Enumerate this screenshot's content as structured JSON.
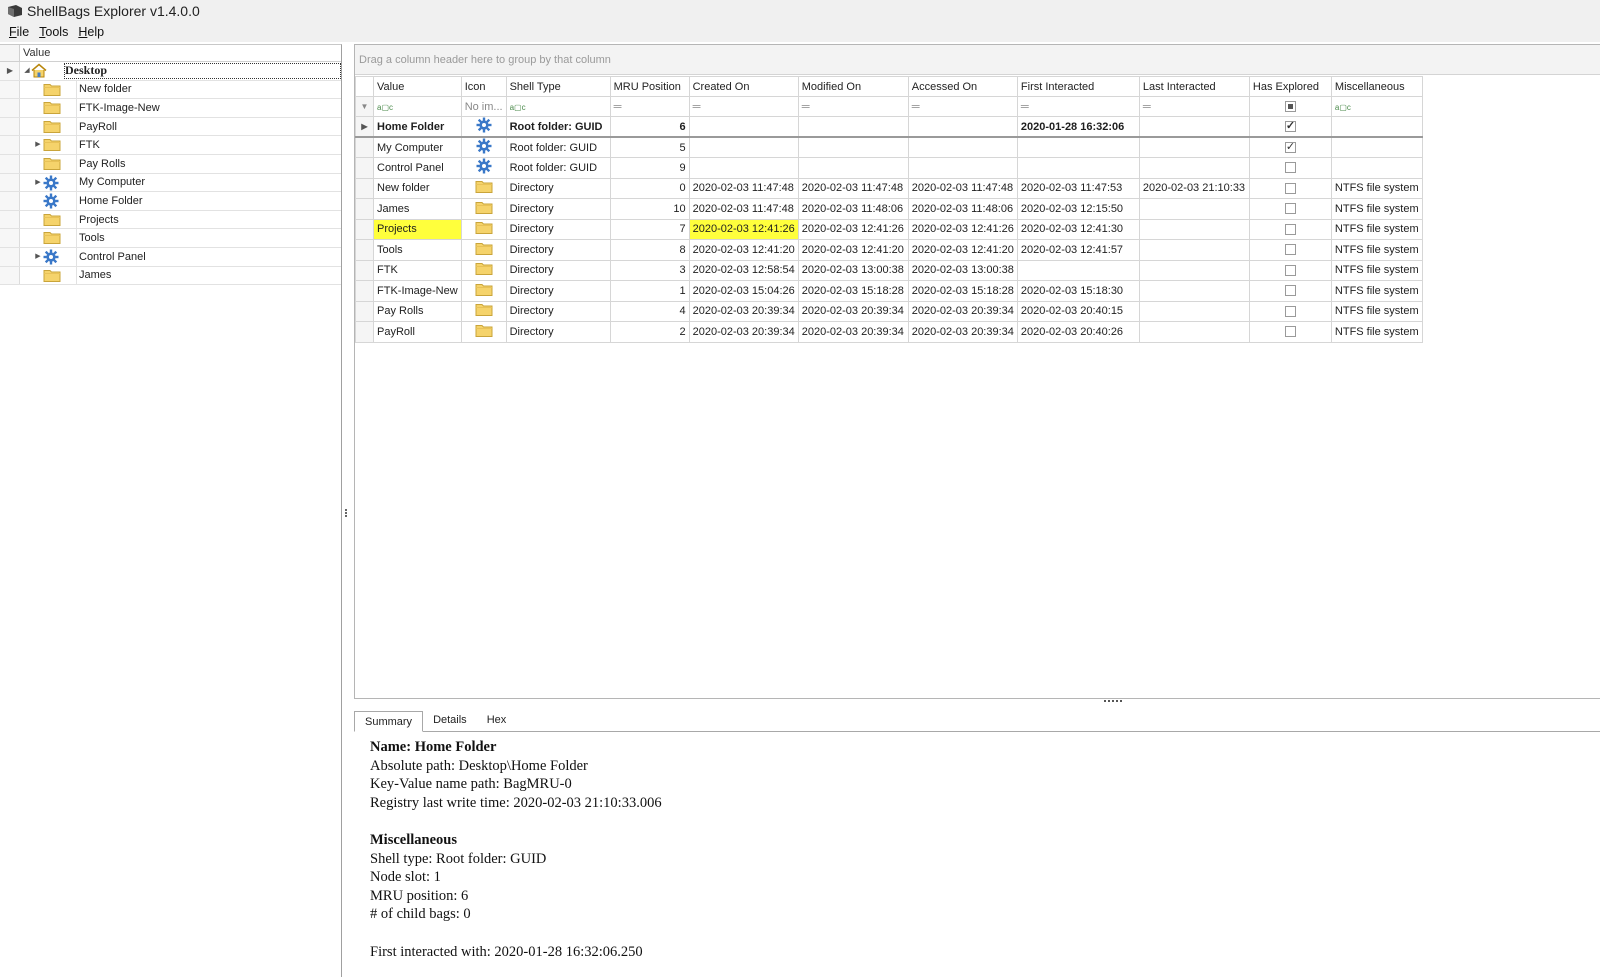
{
  "window": {
    "title": "ShellBags Explorer v1.4.0.0"
  },
  "menu": [
    {
      "label": "File",
      "accel": "F",
      "rest": "ile"
    },
    {
      "label": "Tools",
      "accel": "T",
      "rest": "ools"
    },
    {
      "label": "Help",
      "accel": "H",
      "rest": "elp"
    }
  ],
  "tree": {
    "header": "Value",
    "root": "Desktop",
    "items": [
      {
        "label": "New folder",
        "icon": "folder-icon",
        "expandable": false
      },
      {
        "label": "FTK-Image-New",
        "icon": "folder-icon",
        "expandable": false
      },
      {
        "label": "PayRoll",
        "icon": "folder-icon",
        "expandable": false
      },
      {
        "label": "FTK",
        "icon": "folder-icon",
        "expandable": true
      },
      {
        "label": "Pay Rolls",
        "icon": "folder-icon",
        "expandable": false
      },
      {
        "label": "My Computer",
        "icon": "gear-icon",
        "expandable": true
      },
      {
        "label": "Home Folder",
        "icon": "gear-icon",
        "expandable": false
      },
      {
        "label": "Projects",
        "icon": "folder-icon",
        "expandable": false
      },
      {
        "label": "Tools",
        "icon": "folder-icon",
        "expandable": false
      },
      {
        "label": "Control Panel",
        "icon": "gear-icon",
        "expandable": true
      },
      {
        "label": "James",
        "icon": "folder-icon",
        "expandable": false
      }
    ]
  },
  "grid": {
    "group_hint": "Drag a column header here to group by that column",
    "columns": [
      "Value",
      "Icon",
      "Shell Type",
      "MRU Position",
      "Created On",
      "Modified On",
      "Accessed On",
      "First Interacted",
      "Last Interacted",
      "Has Explored",
      "Miscellaneous"
    ],
    "filter_icon_placeholder": "No im...",
    "rows": [
      {
        "value": "Home Folder",
        "icon": "gear-icon",
        "shell_type": "Root folder: GUID",
        "mru": "6",
        "created": "",
        "modified": "",
        "accessed": "",
        "first": "2020-01-28 16:32:06",
        "last": "",
        "explored": true,
        "misc": ""
      },
      {
        "value": "My Computer",
        "icon": "gear-icon",
        "shell_type": "Root folder: GUID",
        "mru": "5",
        "created": "",
        "modified": "",
        "accessed": "",
        "first": "",
        "last": "",
        "explored": true,
        "misc": ""
      },
      {
        "value": "Control Panel",
        "icon": "gear-icon",
        "shell_type": "Root folder: GUID",
        "mru": "9",
        "created": "",
        "modified": "",
        "accessed": "",
        "first": "",
        "last": "",
        "explored": false,
        "misc": ""
      },
      {
        "value": "New folder",
        "icon": "folder-icon",
        "shell_type": "Directory",
        "mru": "0",
        "created": "2020-02-03 11:47:48",
        "modified": "2020-02-03 11:47:48",
        "accessed": "2020-02-03 11:47:48",
        "first": "2020-02-03 11:47:53",
        "last": "2020-02-03 21:10:33",
        "explored": false,
        "misc": "NTFS file system"
      },
      {
        "value": "James",
        "icon": "folder-icon",
        "shell_type": "Directory",
        "mru": "10",
        "created": "2020-02-03 11:47:48",
        "modified": "2020-02-03 11:48:06",
        "accessed": "2020-02-03 11:48:06",
        "first": "2020-02-03 12:15:50",
        "last": "",
        "explored": false,
        "misc": "NTFS file system"
      },
      {
        "value": "Projects",
        "icon": "folder-icon",
        "shell_type": "Directory",
        "mru": "7",
        "created": "2020-02-03 12:41:26",
        "modified": "2020-02-03 12:41:26",
        "accessed": "2020-02-03 12:41:26",
        "first": "2020-02-03 12:41:30",
        "last": "",
        "explored": false,
        "misc": "NTFS file system"
      },
      {
        "value": "Tools",
        "icon": "folder-icon",
        "shell_type": "Directory",
        "mru": "8",
        "created": "2020-02-03 12:41:20",
        "modified": "2020-02-03 12:41:20",
        "accessed": "2020-02-03 12:41:20",
        "first": "2020-02-03 12:41:57",
        "last": "",
        "explored": false,
        "misc": "NTFS file system"
      },
      {
        "value": "FTK",
        "icon": "folder-icon",
        "shell_type": "Directory",
        "mru": "3",
        "created": "2020-02-03 12:58:54",
        "modified": "2020-02-03 13:00:38",
        "accessed": "2020-02-03 13:00:38",
        "first": "",
        "last": "",
        "explored": false,
        "misc": "NTFS file system"
      },
      {
        "value": "FTK-Image-New",
        "icon": "folder-icon",
        "shell_type": "Directory",
        "mru": "1",
        "created": "2020-02-03 15:04:26",
        "modified": "2020-02-03 15:18:28",
        "accessed": "2020-02-03 15:18:28",
        "first": "2020-02-03 15:18:30",
        "last": "",
        "explored": false,
        "misc": "NTFS file system"
      },
      {
        "value": "Pay Rolls",
        "icon": "folder-icon",
        "shell_type": "Directory",
        "mru": "4",
        "created": "2020-02-03 20:39:34",
        "modified": "2020-02-03 20:39:34",
        "accessed": "2020-02-03 20:39:34",
        "first": "2020-02-03 20:40:15",
        "last": "",
        "explored": false,
        "misc": "NTFS file system"
      },
      {
        "value": "PayRoll",
        "icon": "folder-icon",
        "shell_type": "Directory",
        "mru": "2",
        "created": "2020-02-03 20:39:34",
        "modified": "2020-02-03 20:39:34",
        "accessed": "2020-02-03 20:39:34",
        "first": "2020-02-03 20:40:26",
        "last": "",
        "explored": false,
        "misc": "NTFS file system"
      }
    ]
  },
  "detail": {
    "tabs": [
      "Summary",
      "Details",
      "Hex"
    ],
    "summary": {
      "name": "Name: Home Folder",
      "absolute_path": "Absolute path: Desktop\\Home Folder",
      "key_value_path": "Key-Value name path: BagMRU-0",
      "registry_write": "Registry last write time: 2020-02-03 21:10:33.006",
      "misc_heading": "Miscellaneous",
      "shell_type": "Shell type: Root folder: GUID",
      "node_slot": "Node slot: 1",
      "mru_position": "MRU position: 6",
      "child_bags": "# of child bags: 0",
      "first_interacted": "First interacted with: 2020-01-28 16:32:06.250"
    }
  },
  "colors": {
    "highlight": "#ffff3c",
    "folder": "#f5d36b",
    "gear": "#3a78c8"
  }
}
